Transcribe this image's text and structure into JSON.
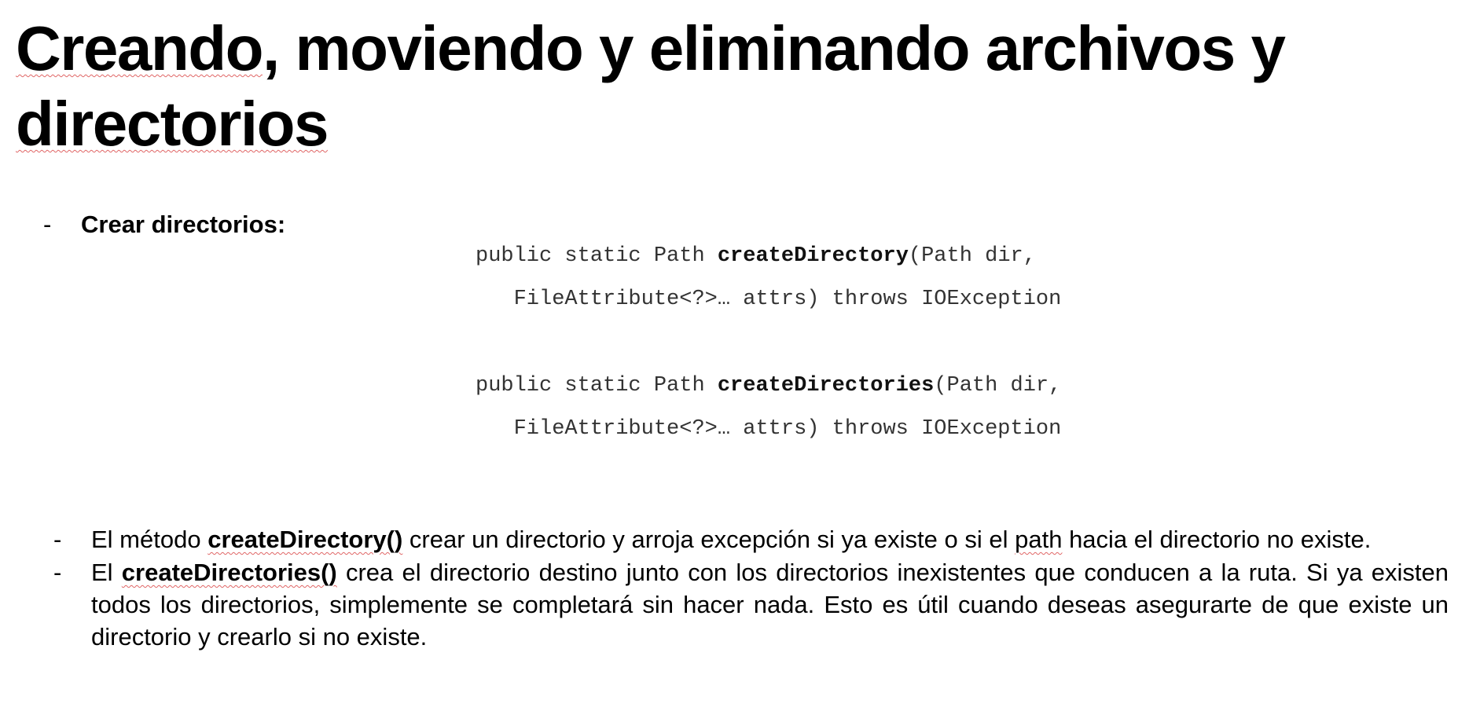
{
  "title_part1": "Creando",
  "title_part2": ", moviendo y ",
  "title_part3": "eliminando archivos y ",
  "title_part4": "directorios",
  "section_dash": "-",
  "section_heading": "Crear directorios:",
  "code": {
    "sig1_prefix": "public static Path ",
    "sig1_method": "createDirectory",
    "sig1_suffix": "(Path dir,",
    "sig1_line2": "   FileAttribute<?>… attrs) throws IOException",
    "sig2_prefix": "public static Path ",
    "sig2_method": "createDirectories",
    "sig2_suffix": "(Path dir,",
    "sig2_line2": "   FileAttribute<?>… attrs) throws IOException"
  },
  "bullets": [
    {
      "dash": "-",
      "pre": "El método ",
      "bold": "createDirectory()",
      "mid": " crear un directorio y arroja excepción si ya existe o si el ",
      "word": "path",
      "post": " hacia el directorio no existe."
    },
    {
      "dash": "-",
      "pre": "El ",
      "bold": "createDirectories()",
      "post": " crea el directorio destino junto con los directorios inexistentes que conducen a la ruta. Si ya existen todos los directorios, simplemente se completará sin hacer nada. Esto es útil cuando deseas asegurarte de que existe un directorio y crearlo si no existe."
    }
  ]
}
